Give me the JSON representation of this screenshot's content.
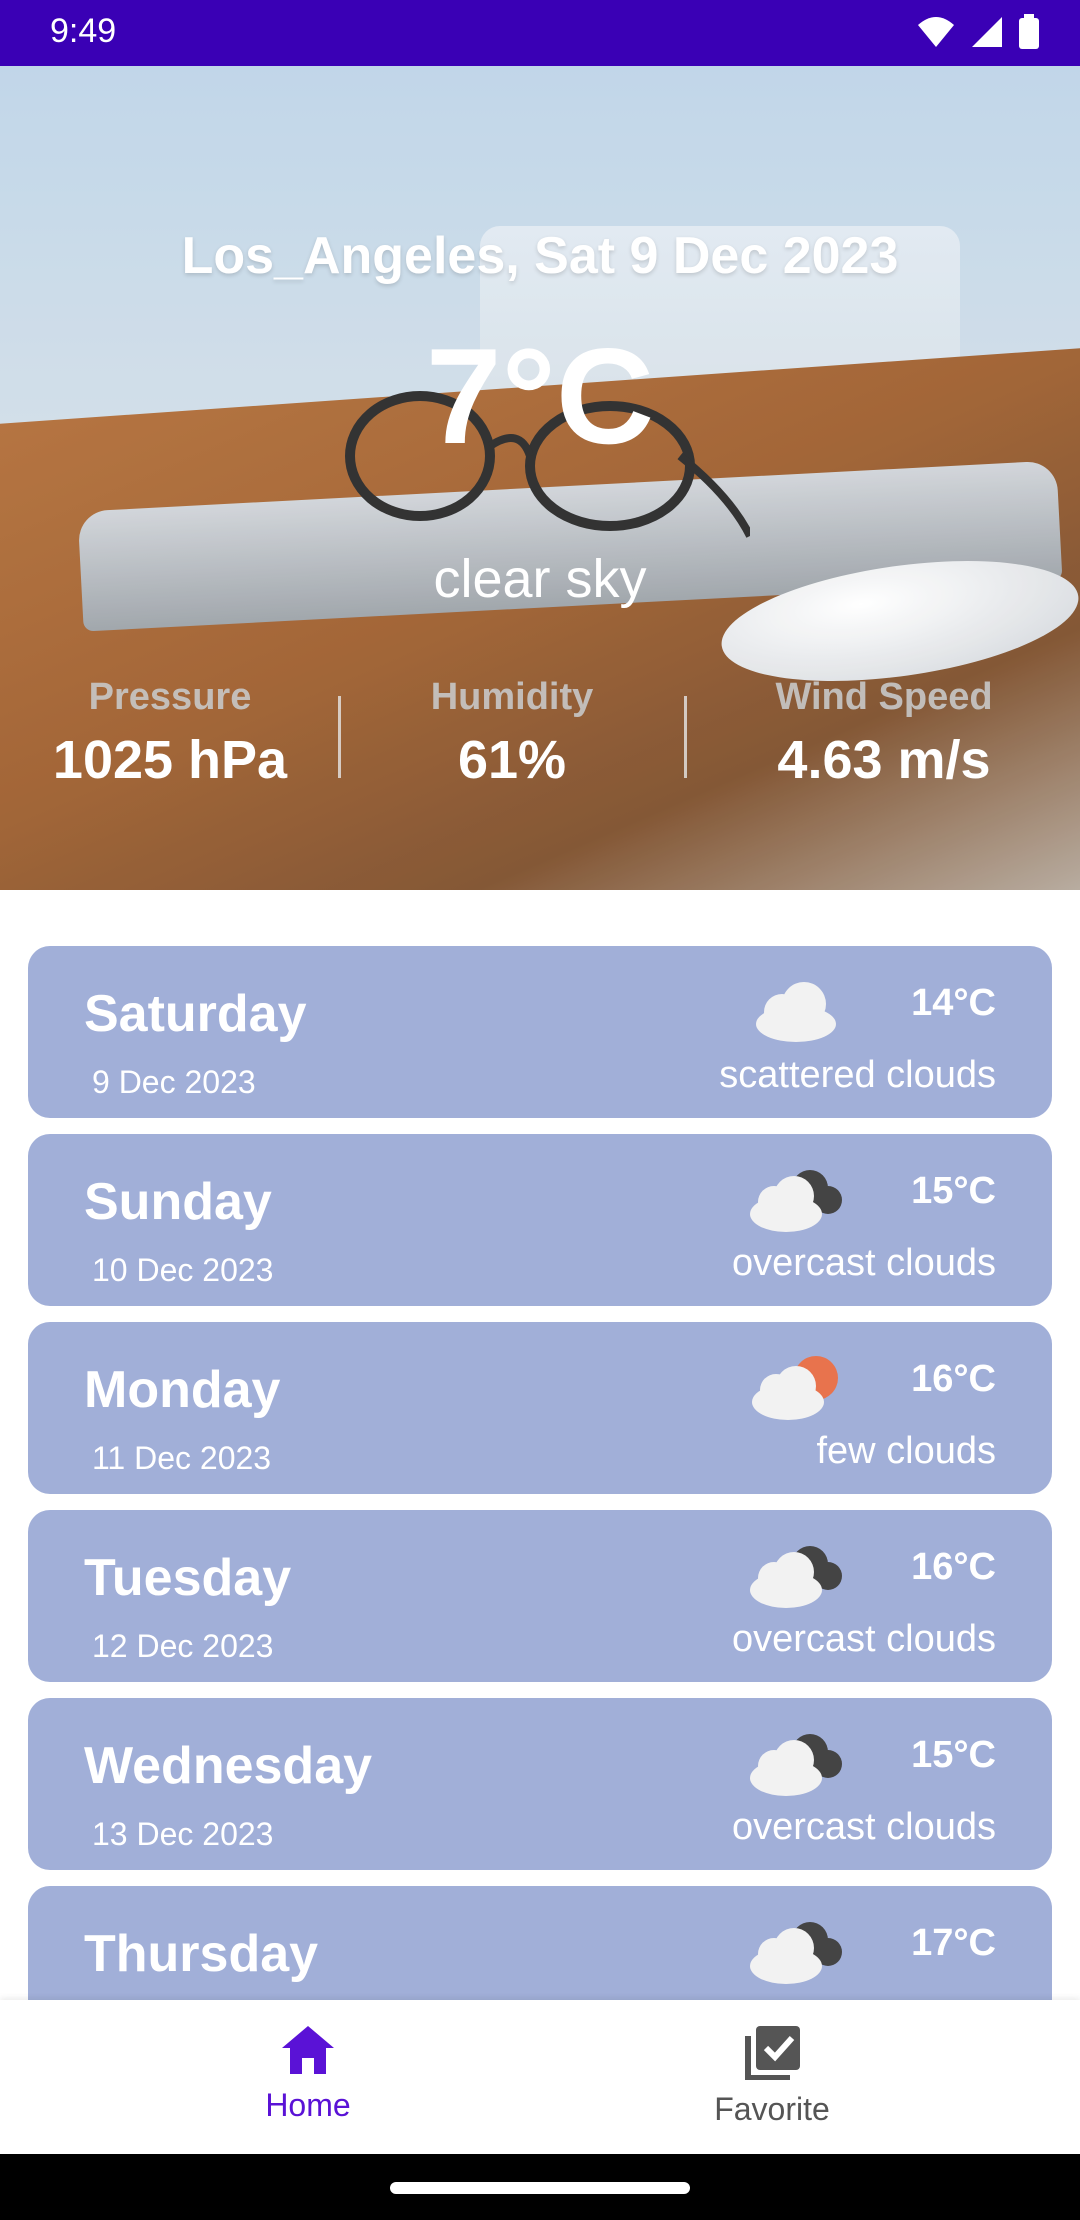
{
  "status_bar": {
    "time": "9:49"
  },
  "hero": {
    "city_date": "Los_Angeles, Sat 9 Dec 2023",
    "temperature": "7°C",
    "condition": "clear sky",
    "metrics": [
      {
        "label": "Pressure",
        "value": "1025 hPa"
      },
      {
        "label": "Humidity",
        "value": "61%"
      },
      {
        "label": "Wind Speed",
        "value": "4.63 m/s"
      }
    ]
  },
  "forecast": [
    {
      "day": "Saturday",
      "date": "9 Dec 2023",
      "temp": "14°C",
      "desc": "scattered clouds",
      "icon": "scattered-clouds-icon"
    },
    {
      "day": "Sunday",
      "date": "10 Dec 2023",
      "temp": "15°C",
      "desc": "overcast clouds",
      "icon": "overcast-clouds-icon"
    },
    {
      "day": "Monday",
      "date": "11 Dec 2023",
      "temp": "16°C",
      "desc": "few clouds",
      "icon": "few-clouds-icon"
    },
    {
      "day": "Tuesday",
      "date": "12 Dec 2023",
      "temp": "16°C",
      "desc": "overcast clouds",
      "icon": "overcast-clouds-icon"
    },
    {
      "day": "Wednesday",
      "date": "13 Dec 2023",
      "temp": "15°C",
      "desc": "overcast clouds",
      "icon": "overcast-clouds-icon"
    },
    {
      "day": "Thursday",
      "date": "",
      "temp": "17°C",
      "desc": "",
      "icon": "overcast-clouds-icon"
    }
  ],
  "bottom_nav": {
    "home_label": "Home",
    "favorite_label": "Favorite",
    "active_color": "#5a12d6",
    "inactive_color": "#555555"
  },
  "colors": {
    "status_bar": "#3a00b5",
    "card": "#a1afd8"
  }
}
